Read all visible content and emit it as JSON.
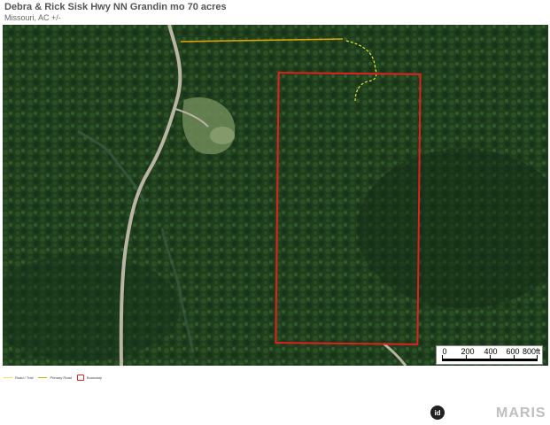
{
  "header": {
    "title": "Debra & Rick Sisk Hwy NN Grandin mo 70 acres",
    "subtitle": "Missouri,  AC +/-"
  },
  "map": {
    "colors": {
      "forest": "#1f3f1c",
      "clearing": "#6f8a58",
      "road": "#b9b4a4",
      "boundary": "#e32020",
      "primary_road": "#e2a500",
      "trail": "#e6e63a"
    }
  },
  "scale": {
    "labels": [
      "0",
      "200",
      "400",
      "600",
      "800ft"
    ]
  },
  "legend": {
    "trail": "Road / Trail",
    "primary_road": "Primary Road",
    "boundary": "Boundary"
  },
  "footer": {
    "logo": "id",
    "brand": "MARIS"
  }
}
